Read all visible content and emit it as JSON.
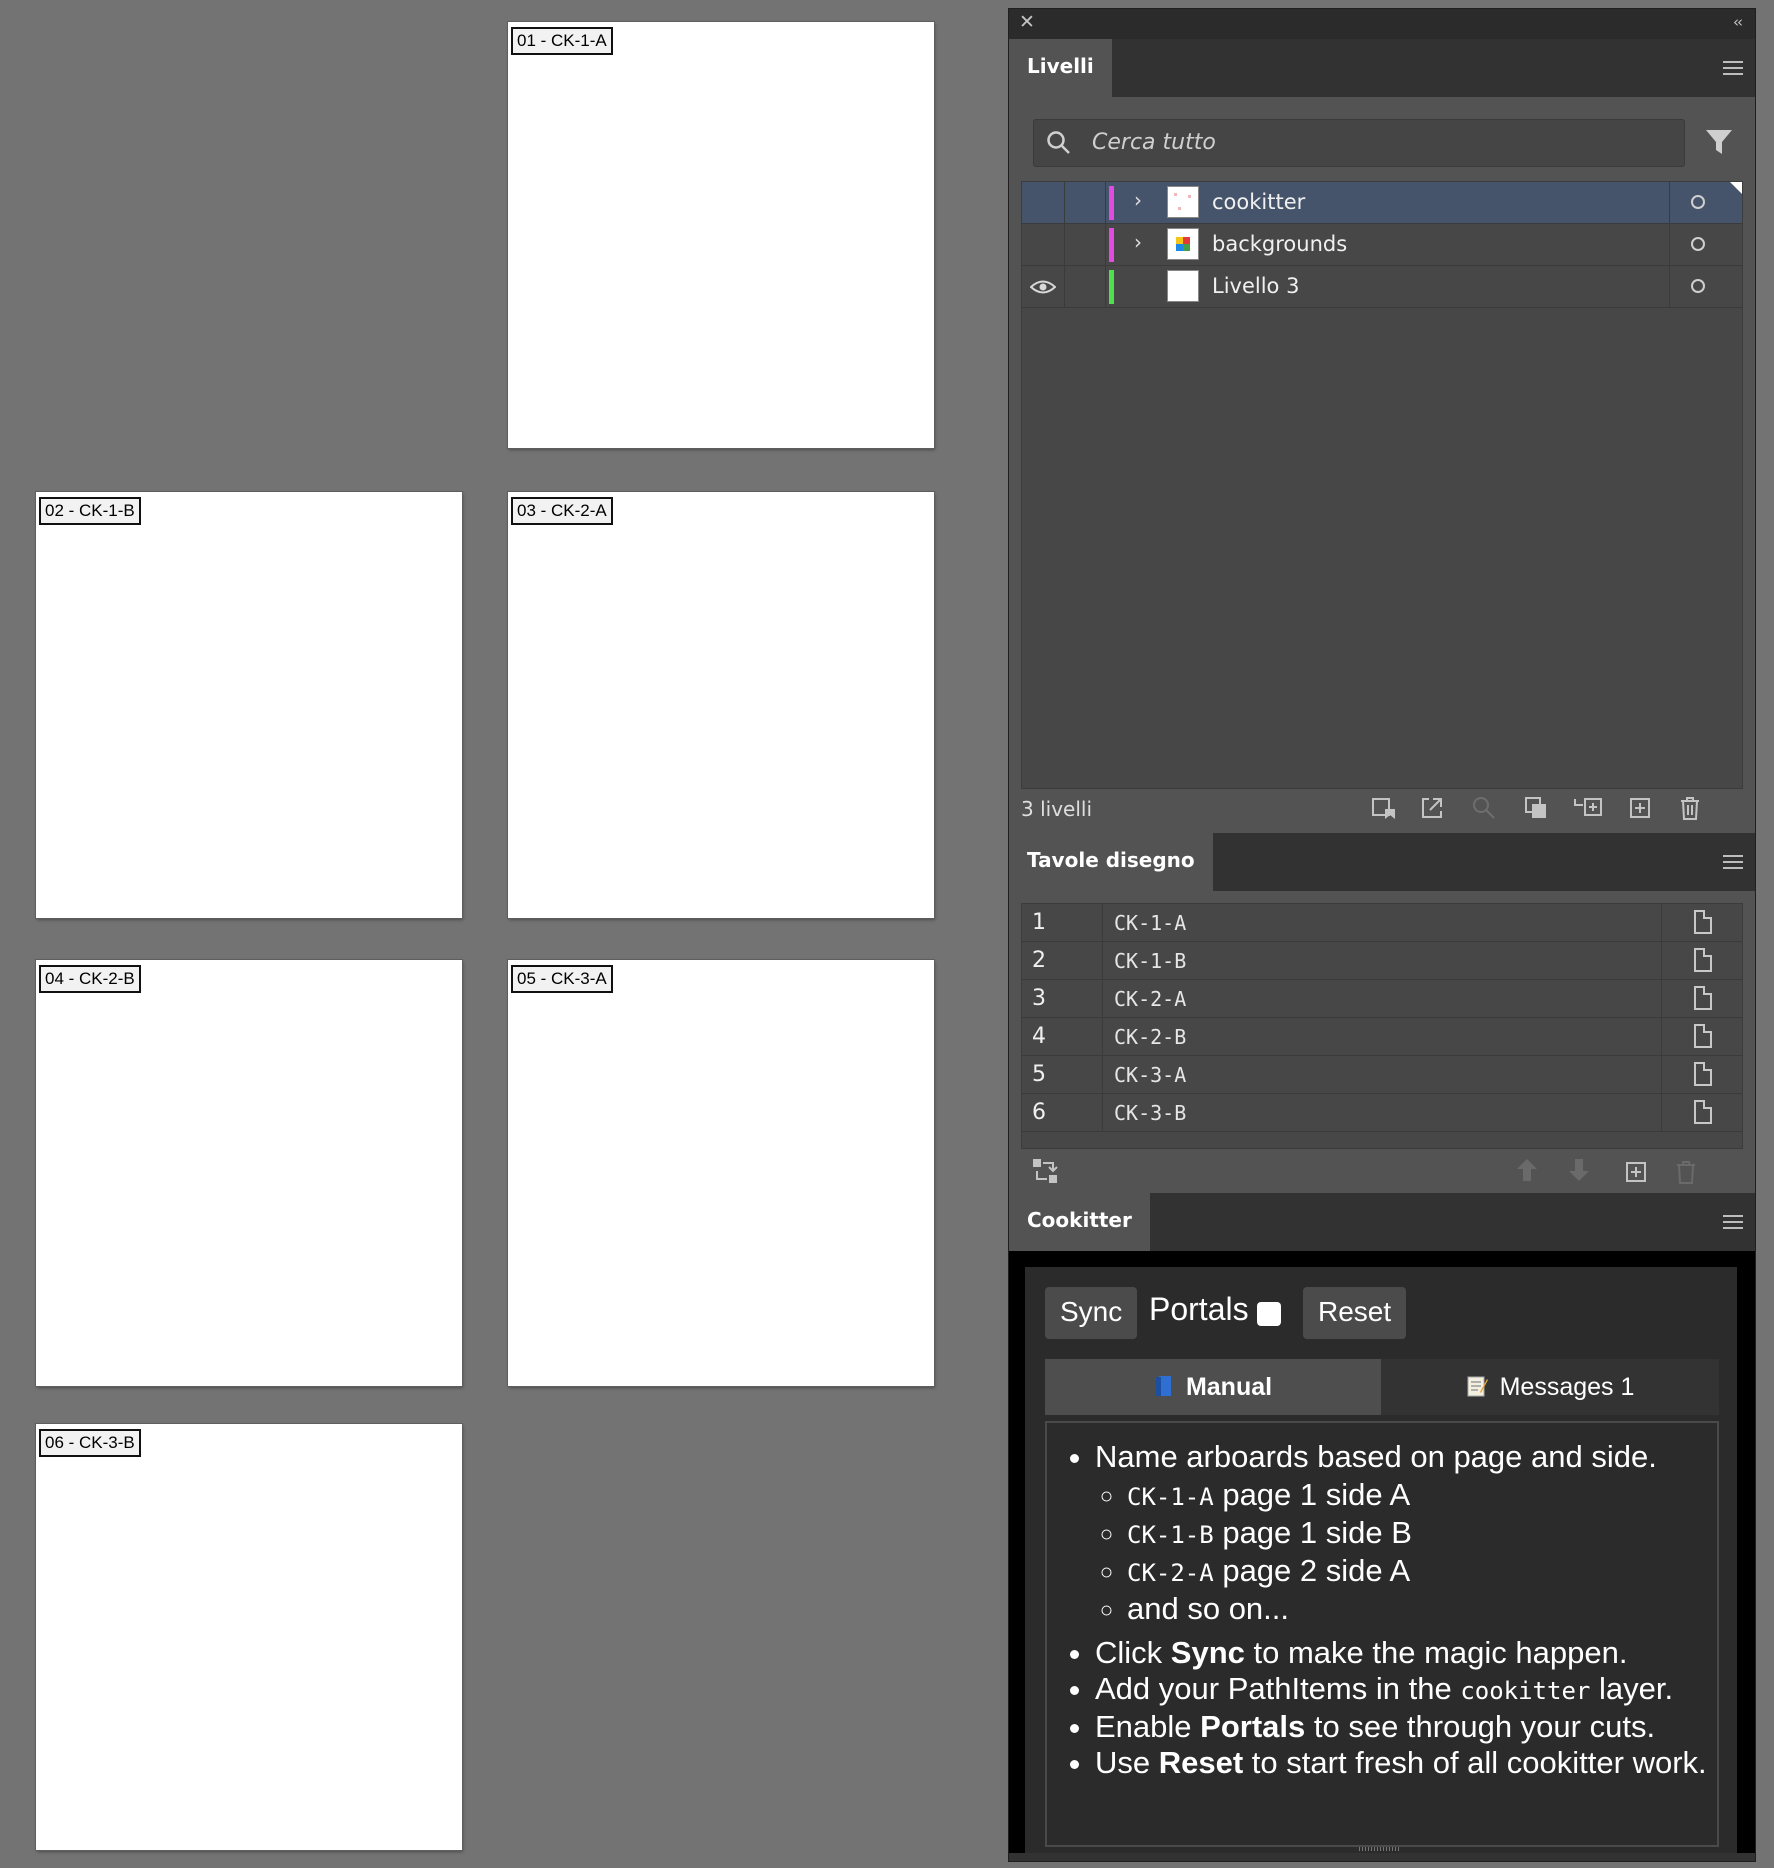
{
  "artboards": [
    {
      "label": "01 - CK-1-A"
    },
    {
      "label": "02 - CK-1-B"
    },
    {
      "label": "03 - CK-2-A"
    },
    {
      "label": "04 - CK-2-B"
    },
    {
      "label": "05 - CK-3-A"
    },
    {
      "label": "06 - CK-3-B"
    }
  ],
  "layers_panel": {
    "tab": "Livelli",
    "search_placeholder": "Cerca tutto",
    "layers": [
      {
        "name": "cookitter",
        "color": "#e14be0",
        "selected": true,
        "visible": false,
        "expandable": true
      },
      {
        "name": "backgrounds",
        "color": "#e14be0",
        "selected": false,
        "visible": false,
        "expandable": true
      },
      {
        "name": "Livello 3",
        "color": "#4fe04f",
        "selected": false,
        "visible": true,
        "expandable": false
      }
    ],
    "count_label": "3 livelli"
  },
  "artboards_panel": {
    "tab": "Tavole disegno",
    "rows": [
      {
        "num": "1",
        "name": "CK-1-A"
      },
      {
        "num": "2",
        "name": "CK-1-B"
      },
      {
        "num": "3",
        "name": "CK-2-A"
      },
      {
        "num": "4",
        "name": "CK-2-B"
      },
      {
        "num": "5",
        "name": "CK-3-A"
      },
      {
        "num": "6",
        "name": "CK-3-B"
      }
    ]
  },
  "cookitter_panel": {
    "tab": "Cookitter",
    "sync_label": "Sync",
    "portals_label": "Portals",
    "reset_label": "Reset",
    "tabs": [
      {
        "label": "Manual",
        "icon": "book-icon",
        "active": true
      },
      {
        "label": "Messages 1",
        "icon": "memo-icon",
        "active": false
      }
    ],
    "manual": {
      "intro": "Name arboards based on page and side.",
      "examples": [
        {
          "code": "CK-1-A",
          "text": "page 1 side A"
        },
        {
          "code": "CK-1-B",
          "text": "page 1 side B"
        },
        {
          "code": "CK-2-A",
          "text": "page 2 side A"
        }
      ],
      "more": "and so on...",
      "tips": [
        {
          "before": "Click ",
          "strong": "Sync",
          "after": " to make the magic happen."
        },
        {
          "before": "Add your PathItems in the ",
          "code": "cookitter",
          "after": " layer."
        },
        {
          "before": "Enable ",
          "strong": "Portals",
          "after": " to see through your cuts."
        },
        {
          "before": "Use ",
          "strong": "Reset",
          "after": " to start fresh of all cookitter work."
        }
      ]
    }
  },
  "colors": {
    "canvas": "#737373",
    "panel": "#535353",
    "selected_row": "#46546b"
  }
}
